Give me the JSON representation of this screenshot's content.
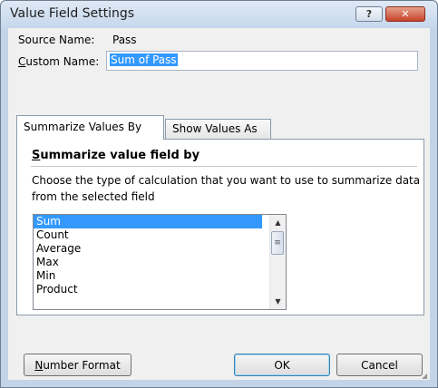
{
  "window": {
    "title": "Value Field Settings",
    "help_glyph": "?",
    "close_glyph": "✕"
  },
  "source": {
    "label": "Source Name:",
    "value": "Pass"
  },
  "custom_name": {
    "label_prefix_underlined": "C",
    "label_rest": "ustom Name:",
    "value": "Sum of Pass"
  },
  "tabs": [
    {
      "label": "Summarize Values By",
      "active": true
    },
    {
      "label": "Show Values As",
      "active": false
    }
  ],
  "panel": {
    "heading_underlined": "S",
    "heading_rest": "ummarize value field by",
    "description": "Choose the type of calculation that you want to use to summarize data from the selected field"
  },
  "list": {
    "items": [
      "Sum",
      "Count",
      "Average",
      "Max",
      "Min",
      "Product"
    ],
    "selected": "Sum"
  },
  "buttons": {
    "number_format_underlined": "N",
    "number_format_rest": "umber Format",
    "ok": "OK",
    "cancel": "Cancel"
  }
}
